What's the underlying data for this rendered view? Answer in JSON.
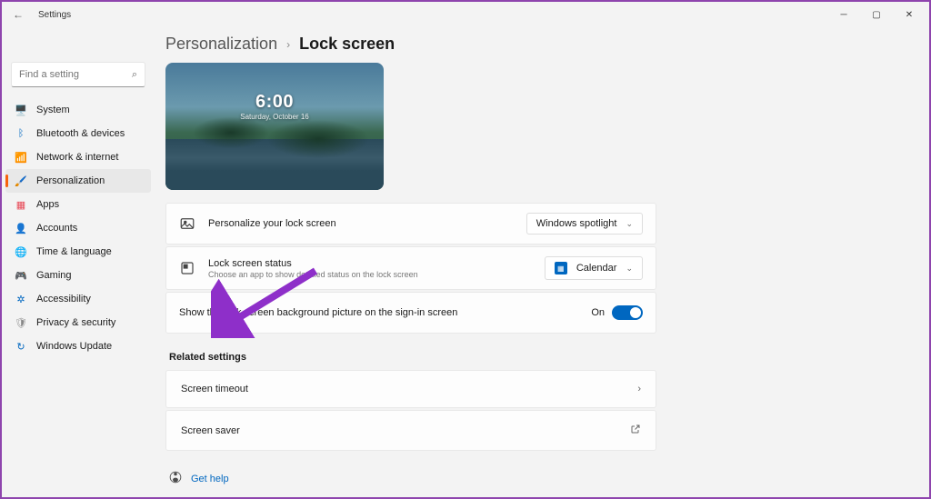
{
  "window": {
    "title": "Settings"
  },
  "search": {
    "placeholder": "Find a setting"
  },
  "nav": [
    {
      "label": "System",
      "icon": "🖥️",
      "color": "#0067c0"
    },
    {
      "label": "Bluetooth & devices",
      "icon": "ᛒ",
      "color": "#0067c0"
    },
    {
      "label": "Network & internet",
      "icon": "📶",
      "color": "#0067c0"
    },
    {
      "label": "Personalization",
      "icon": "🖌️",
      "color": "#f7630c",
      "active": true
    },
    {
      "label": "Apps",
      "icon": "▦",
      "color": "#e74856"
    },
    {
      "label": "Accounts",
      "icon": "👤",
      "color": "#888"
    },
    {
      "label": "Time & language",
      "icon": "🌐",
      "color": "#888"
    },
    {
      "label": "Gaming",
      "icon": "🎮",
      "color": "#888"
    },
    {
      "label": "Accessibility",
      "icon": "✲",
      "color": "#0067c0"
    },
    {
      "label": "Privacy & security",
      "icon": "🛡",
      "color": "#888"
    },
    {
      "label": "Windows Update",
      "icon": "↻",
      "color": "#0067c0"
    }
  ],
  "breadcrumb": {
    "parent": "Personalization",
    "current": "Lock screen"
  },
  "preview": {
    "time": "6:00",
    "date": "Saturday, October 16"
  },
  "cards": {
    "personalize": {
      "title": "Personalize your lock screen",
      "value": "Windows spotlight"
    },
    "status": {
      "title": "Lock screen status",
      "sub": "Choose an app to show detailed status on the lock screen",
      "value": "Calendar"
    },
    "signin": {
      "title": "Show the lock screen background picture on the sign-in screen",
      "toggle_label": "On",
      "toggle_on": true
    }
  },
  "related": {
    "heading": "Related settings",
    "items": [
      {
        "label": "Screen timeout",
        "type": "nav"
      },
      {
        "label": "Screen saver",
        "type": "external"
      }
    ]
  },
  "help": {
    "label": "Get help"
  }
}
